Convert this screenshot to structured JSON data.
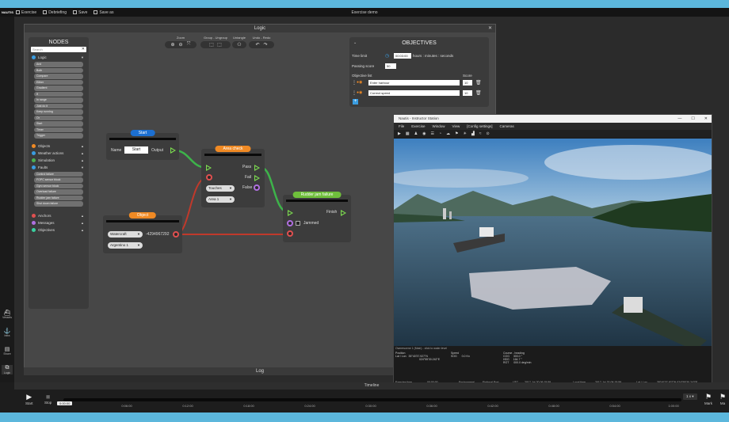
{
  "app": {
    "brand": "NAUTIS",
    "window_title": "Exercise demo",
    "menu": [
      "Exercise",
      "Debriefing",
      "Save",
      "Save as"
    ]
  },
  "leftbar": [
    "Vessels",
    "Infra",
    "Shore",
    "Logic",
    "Timeline"
  ],
  "logic": {
    "title": "Logic",
    "log_title": "Log",
    "toolbar": {
      "zoom": "Zoom",
      "group": "Group - Ungroup",
      "untangle": "Untangle",
      "undo": "Undo - Redo"
    }
  },
  "nodes_panel": {
    "title": "NODES",
    "search_placeholder": "Search",
    "categories": [
      {
        "name": "Logic",
        "color": "#3a9ce0",
        "items": [
          "And",
          "Both",
          "Compare",
          "Either",
          "Gradient",
          "If",
          "In range",
          "Just do it",
          "Keep running",
          "Or",
          "Start",
          "Timer",
          "Trigger"
        ]
      },
      {
        "name": "Objects",
        "color": "#f08a24"
      },
      {
        "name": "Weather actions",
        "color": "#3a9ce0"
      },
      {
        "name": "Simulation",
        "color": "#4caf50"
      },
      {
        "name": "Faults",
        "color": "#3a9ce0",
        "items": [
          "Control failure",
          "FOPC sensor block",
          "Gyro sensor block",
          "Overload failure",
          "Rudder jam failure",
          "Shut down failure"
        ]
      },
      {
        "name": "Anchors",
        "color": "#e05050"
      },
      {
        "name": "Messages",
        "color": "#b070e0"
      },
      {
        "name": "Objectives",
        "color": "#3ad0a0"
      }
    ]
  },
  "graph": {
    "start": {
      "title": "Start",
      "name_label": "Name",
      "name_value": "Start",
      "output_label": "Output"
    },
    "area_check": {
      "title": "Area check",
      "pass": "Pass",
      "fail": "Fail",
      "false": "False",
      "mode": "Touches",
      "area": "Area 1"
    },
    "object": {
      "title": "Object",
      "type": "Watercraft",
      "id": "-4294967292",
      "name": "Argentino 1"
    },
    "rudder": {
      "title": "Rudder jam failure",
      "finish": "Finish",
      "jammed": "Jammed"
    }
  },
  "objectives": {
    "title": "OBJECTIVES",
    "time_limit_label": "Time limit",
    "time_limit_value": "00:03:00",
    "time_units": "hours : minutes : seconds",
    "passing_label": "Passing score",
    "passing_value": "50",
    "list_label": "Objective list",
    "score_label": "Score",
    "items": [
      {
        "name": "Enter harbour",
        "score": "10"
      },
      {
        "name": "Correct speed",
        "score": "10"
      }
    ]
  },
  "instructor": {
    "title": "Nautis - Instructor Station",
    "menu": [
      "File",
      "Exercise",
      "Window",
      "View",
      "[Config settings]",
      "Cameras"
    ],
    "status": "Ownerscene 1 (Main) - click to water level",
    "position_label": "Position",
    "latlon_label": "Lat / Lon",
    "lat": "35°40'37.927\"N",
    "lon": "024°55'30.242\"E",
    "speed_label": "Speed",
    "sog_label": "SOG",
    "sog": "0.0 Kn",
    "course_label": "Course - heading",
    "cog_label": "COG",
    "cog": "300.0 °",
    "hdg_label": "HDG",
    "hdg": "164.7 °",
    "rot_label": "ROT",
    "rot": "000.0 deg/min",
    "exercise_time_label": "Exercise time",
    "exercise_time": "00:00:00",
    "environment_label": "Environment",
    "environment": "Fictional Port",
    "utc_label": "UTC",
    "utc": "2017-Jul-20 06:15:59",
    "local_label": "Local time",
    "local": "2017-Jul-20 06:15:59",
    "latlon2_label": "Lat / Lon",
    "latlon2": "35°40'37.927\"N 024°55'30.242\"E"
  },
  "timeline": {
    "title": "Timeline",
    "start": "Start",
    "stop": "Stop",
    "current": "0:00:00",
    "ticks": [
      "0:06:00",
      "0:12:00",
      "0:18:00",
      "0:24:00",
      "0:30:00",
      "0:36:00",
      "0:42:00",
      "0:48:00",
      "0:54:00",
      "1:00:00"
    ],
    "speed": "1 x",
    "mark": "Mark",
    "mark2": "Ma"
  }
}
